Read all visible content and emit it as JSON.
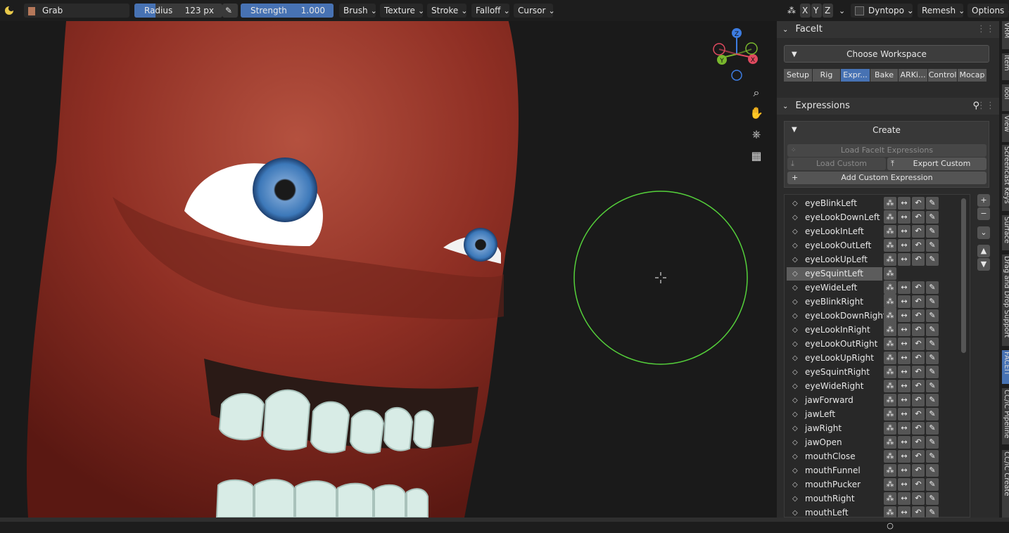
{
  "header": {
    "tool": "Grab",
    "radius_label": "Radius",
    "radius_value": "123 px",
    "strength_label": "Strength",
    "strength_value": "1.000",
    "strength_fraction": 1.0,
    "menus": [
      "Brush",
      "Texture",
      "Stroke",
      "Falloff",
      "Cursor"
    ],
    "axes": [
      "X",
      "Y",
      "Z"
    ],
    "dyntopo": "Dyntopo",
    "remesh": "Remesh",
    "options": "Options"
  },
  "gizmo": {
    "z": "Z",
    "y": "Y",
    "x": "X"
  },
  "faceit": {
    "title": "FaceIt",
    "workspace": "Choose Workspace",
    "tabs": [
      "Setup",
      "Rig",
      "Expr...",
      "Bake",
      "ARKi...",
      "Control",
      "Mocap"
    ],
    "active_tab": "Expr..."
  },
  "expressions": {
    "title": "Expressions",
    "create": "Create",
    "load_faceit": "Load FaceIt Expressions",
    "load_custom": "Load Custom Express...",
    "export_custom": "Export Custom Expres...",
    "add_custom": "Add Custom Expression",
    "items": [
      {
        "name": "eyeBlinkLeft",
        "end": "✕"
      },
      {
        "name": "eyeLookDownLeft",
        "end": "○"
      },
      {
        "name": "eyeLookInLeft",
        "end": "○"
      },
      {
        "name": "eyeLookOutLeft",
        "end": "○"
      },
      {
        "name": "eyeLookUpLeft",
        "end": "○"
      },
      {
        "name": "eyeSquintLeft",
        "end": "✕"
      },
      {
        "name": "eyeWideLeft",
        "end": "○"
      },
      {
        "name": "eyeBlinkRight",
        "end": "✕"
      },
      {
        "name": "eyeLookDownRight",
        "end": "○"
      },
      {
        "name": "eyeLookInRight",
        "end": "○"
      },
      {
        "name": "eyeLookOutRight",
        "end": "○"
      },
      {
        "name": "eyeLookUpRight",
        "end": "○"
      },
      {
        "name": "eyeSquintRight",
        "end": "○"
      },
      {
        "name": "eyeWideRight",
        "end": "○"
      },
      {
        "name": "jawForward",
        "end": "○"
      },
      {
        "name": "jawLeft",
        "end": "○"
      },
      {
        "name": "jawRight",
        "end": "○"
      },
      {
        "name": "jawOpen",
        "end": "○"
      },
      {
        "name": "mouthClose",
        "end": "○"
      },
      {
        "name": "mouthFunnel",
        "end": "○"
      },
      {
        "name": "mouthPucker",
        "end": "○"
      },
      {
        "name": "mouthRight",
        "end": "○"
      },
      {
        "name": "mouthLeft",
        "end": "○"
      }
    ],
    "selected": "eyeSquintLeft"
  },
  "side_tabs": [
    "VRM",
    "Item",
    "Tool",
    "View",
    "Screencast Keys",
    "Surface",
    "Drag and Drop Support",
    "FACEIT",
    "CC/iC Pipeline",
    "CC/iC Create"
  ]
}
